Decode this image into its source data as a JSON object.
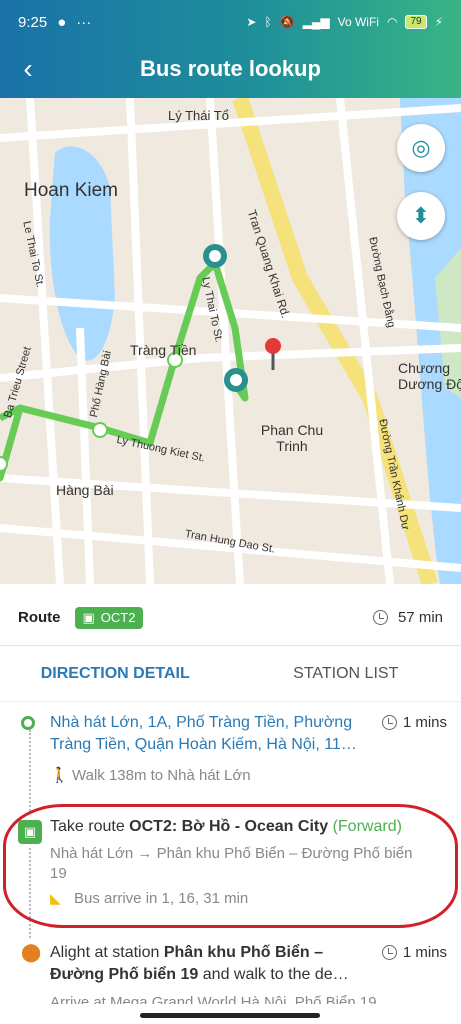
{
  "status": {
    "time": "9:25",
    "right_text": "Vo WiFi",
    "battery": "79"
  },
  "header": {
    "title": "Bus route lookup"
  },
  "map": {
    "labels": {
      "ly_thai_to": "Lý Thái Tổ",
      "hoan_kiem": "Hoan Kiem",
      "tran_quang_khai": "Tran Quang Khai Rd.",
      "duong_bach_dang": "Đường Bạch Đằng",
      "le_thai_to": "Le Thai To St.",
      "ly_thai_to_st": "Ly Thai To St.",
      "trang_tien": "Tràng Tiền",
      "ba_trieu": "Ba Trieu Street",
      "pho_hang_bai": "Phố Hàng Bài",
      "chuong_duong": "Chương Dương Độ",
      "phan_chu_trinh": "Phan Chu Trinh",
      "ly_thuong_kiet": "Ly Thuong Kiet St.",
      "hang_bai": "Hàng Bài",
      "tran_khanh_du": "Đường Trần Khánh Dư",
      "tran_hung_dao": "Tran Hung Dao St."
    }
  },
  "route": {
    "label": "Route",
    "code": "OCT2",
    "duration": "57 min"
  },
  "tabs": {
    "direction": "DIRECTION DETAIL",
    "station": "STATION LIST"
  },
  "steps": {
    "origin": {
      "text": "Nhà hát Lớn, 1A, Phố Tràng Tiền, Phường Tràng Tiền, Quận Hoàn Kiếm, Hà Nội, 11…",
      "time": "1 mins",
      "walk": "Walk 138m to Nhà hát Lớn"
    },
    "bus": {
      "prefix": "Take route",
      "route": "OCT2: Bờ Hồ - Ocean City",
      "direction": "(Forward)",
      "from": "Nhà hát Lớn",
      "to": "Phân khu Phố Biển – Đường Phố biển 19",
      "arrive": "Bus arrive in 1, 16, 31 min"
    },
    "alight": {
      "prefix": "Alight at station",
      "station": "Phân khu Phố Biển – Đường Phố biển 19",
      "suffix": "and walk to the de…",
      "time": "1 mins",
      "extra": "Arrive at Mega Grand World Hà Nội, Phố Biển 19"
    }
  },
  "colors": {
    "route_green": "#4caf50",
    "link_blue": "#2b79b5",
    "highlight_red": "#d0212a"
  }
}
